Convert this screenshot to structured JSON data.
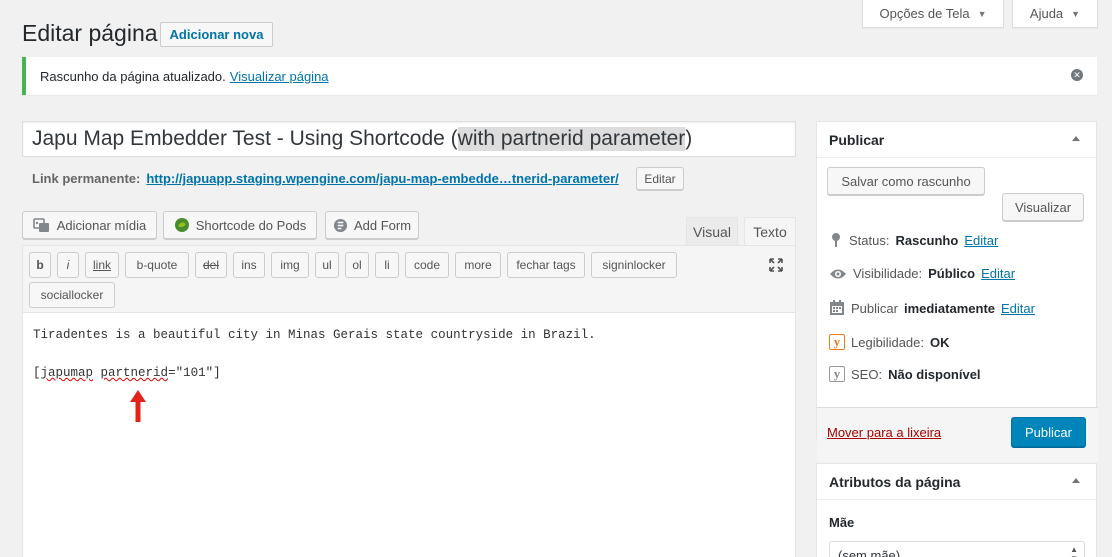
{
  "screen": {
    "options_label": "Opções de Tela",
    "help_label": "Ajuda"
  },
  "header": {
    "title": "Editar página",
    "add_new_label": "Adicionar nova"
  },
  "notice": {
    "message": "Rascunho da página atualizado.",
    "link": "Visualizar página"
  },
  "post": {
    "title_prefix": "Japu Map Embedder Test - Using Shortcode (",
    "title_highlight": "with partnerid parameter",
    "title_suffix": ")"
  },
  "permalink": {
    "label": "Link permanente:",
    "url": "http://japuapp.staging.wpengine.com/japu-map-embedde…tnerid-parameter/",
    "edit_label": "Editar"
  },
  "media": {
    "add_media": "Adicionar mídia",
    "pods_shortcode": "Shortcode do Pods",
    "add_form": "Add Form"
  },
  "tabs": {
    "visual": "Visual",
    "text": "Texto"
  },
  "quicktags": [
    "b",
    "i",
    "link",
    "b-quote",
    "del",
    "ins",
    "img",
    "ul",
    "ol",
    "li",
    "code",
    "more",
    "fechar tags",
    "signinlocker",
    "sociallocker"
  ],
  "content": {
    "line1": "Tiradentes is a beautiful city in Minas Gerais state countryside in Brazil.",
    "line2_open": "[",
    "line2_word1": "japumap",
    "line2_space": " ",
    "line2_word2": "partnerid",
    "line2_rest": "=\"101\"]"
  },
  "publish_box": {
    "title": "Publicar",
    "save_draft": "Salvar como rascunho",
    "preview": "Visualizar",
    "status_label": "Status:",
    "status_value": "Rascunho",
    "visibility_label": "Visibilidade:",
    "visibility_value": "Público",
    "schedule_label": "Publicar",
    "schedule_value": "imediatamente",
    "readability_label": "Legibilidade:",
    "readability_value": "OK",
    "seo_label": "SEO:",
    "seo_value": "Não disponível",
    "edit_label": "Editar",
    "trash": "Mover para a lixeira",
    "publish": "Publicar"
  },
  "attributes_box": {
    "title": "Atributos da página",
    "parent_label": "Mãe",
    "parent_value": "(sem mãe)"
  },
  "colors": {
    "primary": "#0085ba",
    "link": "#0073aa",
    "notice_success": "#46b450",
    "trash": "#a00",
    "readability_ok": "#ee7c1b"
  }
}
